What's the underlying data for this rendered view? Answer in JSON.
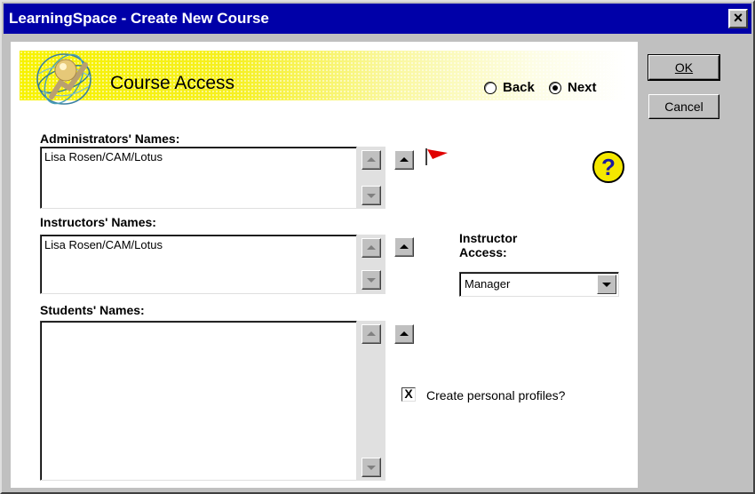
{
  "window": {
    "title": "LearningSpace - Create New Course",
    "close_glyph": "×"
  },
  "banner": {
    "title": "Course Access"
  },
  "navigation": {
    "back_label": "Back",
    "next_label": "Next",
    "selected": "Next"
  },
  "help": {
    "glyph": "?"
  },
  "administrators": {
    "label": "Administrators' Names:",
    "value": "Lisa Rosen/CAM/Lotus"
  },
  "instructors": {
    "label": "Instructors' Names:",
    "value": "Lisa Rosen/CAM/Lotus"
  },
  "students": {
    "label": "Students' Names:",
    "value": ""
  },
  "instructor_access": {
    "label_line1": "Instructor",
    "label_line2": "Access:",
    "selected": "Manager"
  },
  "profiles": {
    "label": "Create personal profiles?",
    "checked": true,
    "mark": "X"
  },
  "buttons": {
    "ok_label": "OK",
    "cancel_label": "Cancel"
  },
  "colors": {
    "titlebar": "#0000a8",
    "banner": "#f7f200",
    "flag": "#e00000",
    "help": "#f5e800"
  }
}
